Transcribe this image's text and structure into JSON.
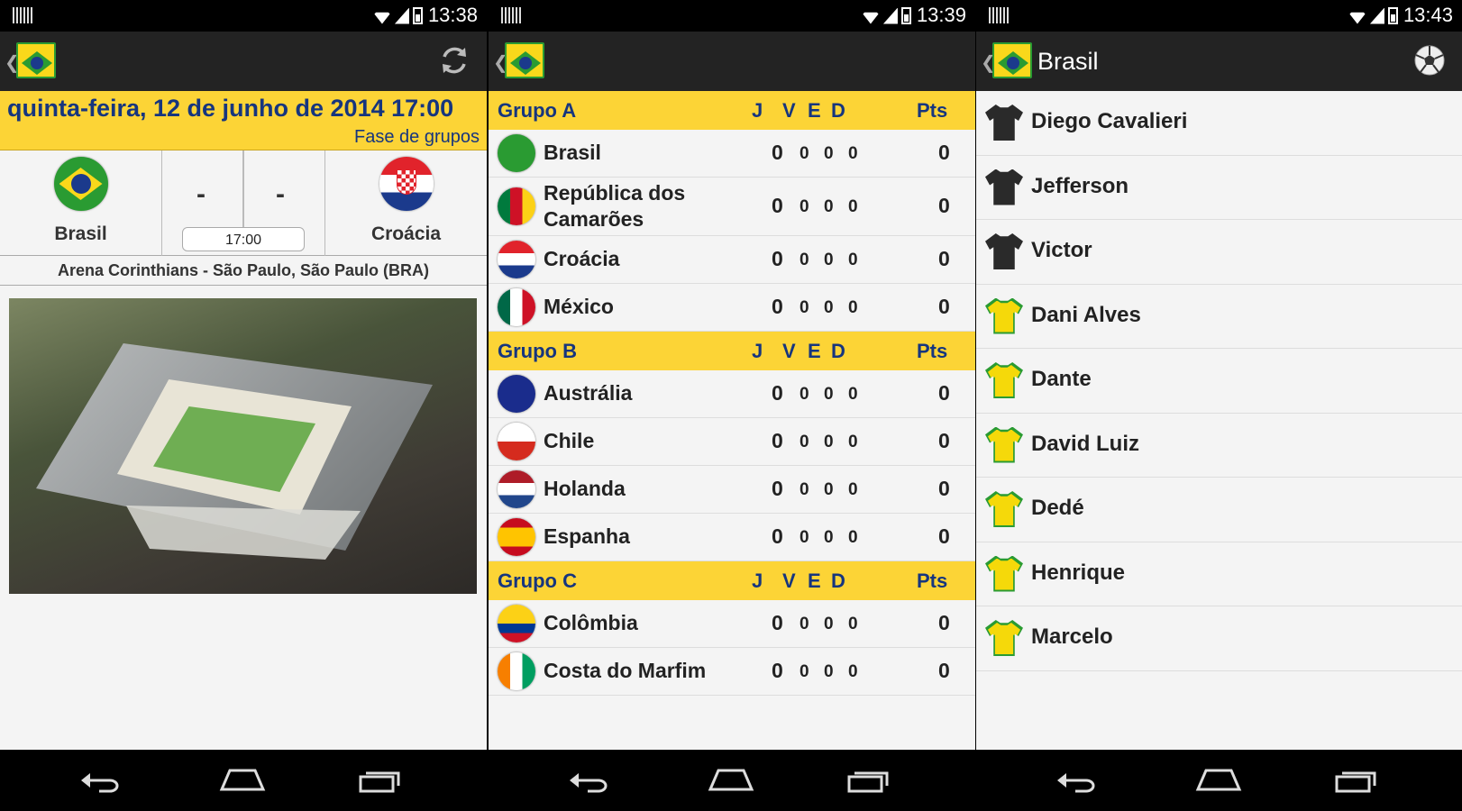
{
  "screens": [
    {
      "status_time": "13:38",
      "match": {
        "datetime": "quinta-feira, 12 de junho de 2014 17:00",
        "phase": "Fase de grupos",
        "home_team": "Brasil",
        "away_team": "Croácia",
        "home_score": "-",
        "away_score": "-",
        "kickoff": "17:00",
        "venue": "Arena Corinthians - São Paulo, São Paulo (BRA)"
      }
    },
    {
      "status_time": "13:39",
      "columns": {
        "j": "J",
        "v": "V",
        "e": "E",
        "d": "D",
        "pts": "Pts"
      },
      "groups": [
        {
          "name": "Grupo A",
          "teams": [
            {
              "name": "Brasil",
              "j": "0",
              "v": "0",
              "e": "0",
              "d": "0",
              "pts": "0"
            },
            {
              "name": "República dos Camarões",
              "j": "0",
              "v": "0",
              "e": "0",
              "d": "0",
              "pts": "0"
            },
            {
              "name": "Croácia",
              "j": "0",
              "v": "0",
              "e": "0",
              "d": "0",
              "pts": "0"
            },
            {
              "name": "México",
              "j": "0",
              "v": "0",
              "e": "0",
              "d": "0",
              "pts": "0"
            }
          ]
        },
        {
          "name": "Grupo B",
          "teams": [
            {
              "name": "Austrália",
              "j": "0",
              "v": "0",
              "e": "0",
              "d": "0",
              "pts": "0"
            },
            {
              "name": "Chile",
              "j": "0",
              "v": "0",
              "e": "0",
              "d": "0",
              "pts": "0"
            },
            {
              "name": "Holanda",
              "j": "0",
              "v": "0",
              "e": "0",
              "d": "0",
              "pts": "0"
            },
            {
              "name": "Espanha",
              "j": "0",
              "v": "0",
              "e": "0",
              "d": "0",
              "pts": "0"
            }
          ]
        },
        {
          "name": "Grupo C",
          "teams": [
            {
              "name": "Colômbia",
              "j": "0",
              "v": "0",
              "e": "0",
              "d": "0",
              "pts": "0"
            },
            {
              "name": "Costa do Marfim",
              "j": "0",
              "v": "0",
              "e": "0",
              "d": "0",
              "pts": "0"
            }
          ]
        }
      ]
    },
    {
      "status_time": "13:43",
      "title": "Brasil",
      "players": [
        {
          "name": "Diego Cavalieri",
          "shirt": "dark"
        },
        {
          "name": "Jefferson",
          "shirt": "dark"
        },
        {
          "name": "Victor",
          "shirt": "dark"
        },
        {
          "name": "Dani Alves",
          "shirt": "yellow"
        },
        {
          "name": "Dante",
          "shirt": "yellow"
        },
        {
          "name": "David Luiz",
          "shirt": "yellow"
        },
        {
          "name": "Dedé",
          "shirt": "yellow"
        },
        {
          "name": "Henrique",
          "shirt": "yellow"
        },
        {
          "name": "Marcelo",
          "shirt": "yellow"
        }
      ]
    }
  ],
  "colors": {
    "accent_yellow": "#fcd436",
    "title_blue": "#16357e",
    "action_bar": "#232323"
  },
  "icons": [
    "refresh-icon",
    "soccer-ball-icon",
    "back-nav-icon",
    "home-nav-icon",
    "recents-nav-icon"
  ]
}
